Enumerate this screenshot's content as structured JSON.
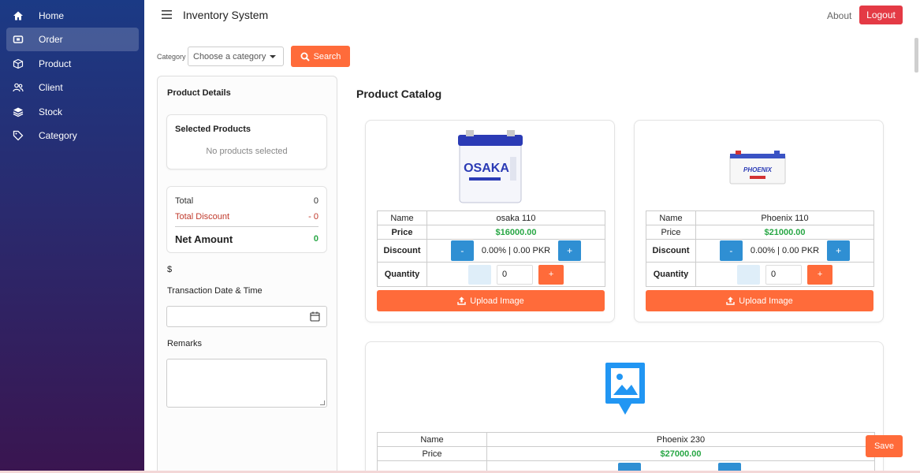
{
  "sidebar": {
    "items": [
      {
        "label": "Home",
        "icon": "home-icon"
      },
      {
        "label": "Order",
        "icon": "order-icon",
        "active": true
      },
      {
        "label": "Product",
        "icon": "box-icon"
      },
      {
        "label": "Client",
        "icon": "users-icon"
      },
      {
        "label": "Stock",
        "icon": "layers-icon"
      },
      {
        "label": "Category",
        "icon": "tag-icon"
      }
    ]
  },
  "header": {
    "title": "Inventory System",
    "about": "About",
    "logout": "Logout"
  },
  "filter": {
    "label": "Category",
    "placeholder": "Choose a category",
    "search": "Search"
  },
  "details": {
    "title": "Product Details",
    "selected_title": "Selected Products",
    "empty": "No products selected",
    "total_label": "Total",
    "total_value": "0",
    "discount_label": "Total Discount",
    "discount_value": "- 0",
    "net_label": "Net Amount",
    "net_value": "0",
    "currency": "$",
    "date_label": "Transaction Date & Time",
    "remarks_label": "Remarks"
  },
  "catalog": {
    "title": "Product Catalog",
    "labels": {
      "name": "Name",
      "price": "Price",
      "discount": "Discount",
      "quantity": "Quantity",
      "upload": "Upload Image"
    },
    "products": [
      {
        "name": "osaka 110",
        "price": "$16000.00",
        "discount": "0.00% | 0.00 PKR",
        "qty": "0"
      },
      {
        "name": "Phoenix 110",
        "price": "$21000.00",
        "discount": "0.00% | 0.00 PKR",
        "qty": "0"
      },
      {
        "name": "Phoenix 230",
        "price": "$27000.00"
      }
    ],
    "osaka_brand": "OSAKA",
    "phoenix_brand": "PHOENIX"
  },
  "actions": {
    "save": "Save",
    "minus": "-",
    "plus": "+"
  },
  "colors": {
    "accent": "#ff6b3a",
    "blue": "#2f8fd3",
    "green": "#28a745",
    "red": "#e43a45"
  }
}
